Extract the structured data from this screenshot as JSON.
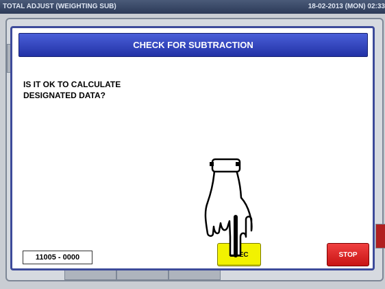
{
  "window": {
    "title": "TOTAL ADJUST (WEIGHTING SUB)",
    "datetime": "18-02-2013 (MON) 02:33"
  },
  "dialog": {
    "title": "CHECK FOR SUBTRACTION",
    "message_line1": "IS IT OK TO CALCULATE",
    "message_line2": "DESIGNATED DATA?",
    "code": "11005 - 0000",
    "exec_label": "EXEC",
    "stop_label": "STOP"
  },
  "colors": {
    "header_blue": "#2f43c4",
    "exec_yellow": "#f2f200",
    "stop_red": "#d81e1e"
  },
  "icons": {
    "pointer": "pointing-hand-icon"
  }
}
